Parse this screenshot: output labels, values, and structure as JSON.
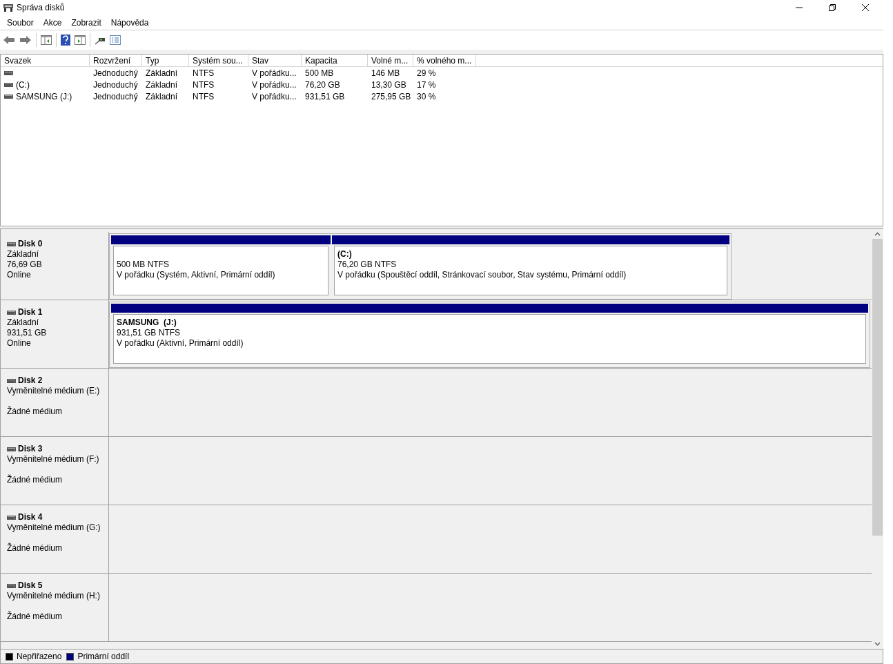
{
  "window": {
    "title": "Správa disků"
  },
  "menu": [
    "Soubor",
    "Akce",
    "Zobrazit",
    "Nápověda"
  ],
  "table": {
    "columns": [
      "Svazek",
      "Rozvržení",
      "Typ",
      "Systém sou...",
      "Stav",
      "Kapacita",
      "Volné m...",
      "% volného m..."
    ],
    "rows": [
      {
        "cells": [
          "",
          "Jednoduchý",
          "Základní",
          "NTFS",
          "V pořádku...",
          "500 MB",
          "146 MB",
          "29 %"
        ]
      },
      {
        "cells": [
          "(C:)",
          "Jednoduchý",
          "Základní",
          "NTFS",
          "V pořádku...",
          "76,20 GB",
          "13,30 GB",
          "17 %"
        ]
      },
      {
        "cells": [
          "SAMSUNG (J:)",
          "Jednoduchý",
          "Základní",
          "NTFS",
          "V pořádku...",
          "931,51 GB",
          "275,95 GB",
          "30 %"
        ]
      }
    ]
  },
  "disks": [
    {
      "kind": "basic",
      "name": "Disk 0",
      "type": "Základní",
      "size": "76,69 GB",
      "status": "Online",
      "partitions": [
        {
          "size_fs": "500 MB NTFS",
          "status": "V pořádku (Systém, Aktivní, Primární oddíl)"
        },
        {
          "label": "(C:)",
          "size_fs": "76,20 GB NTFS",
          "status": "V pořádku (Spouštěcí oddíl, Stránkovací soubor, Stav systému, Primární oddíl)"
        }
      ]
    },
    {
      "kind": "basic",
      "name": "Disk 1",
      "type": "Základní",
      "size": "931,51 GB",
      "status": "Online",
      "partitions": [
        {
          "label": "SAMSUNG  (J:)",
          "size_fs": "931,51 GB NTFS",
          "status": "V pořádku (Aktivní, Primární oddíl)"
        }
      ]
    },
    {
      "kind": "removable",
      "name": "Disk 2",
      "type": "Vyměnitelné médium (E:)",
      "status": "Žádné médium"
    },
    {
      "kind": "removable",
      "name": "Disk 3",
      "type": "Vyměnitelné médium (F:)",
      "status": "Žádné médium"
    },
    {
      "kind": "removable",
      "name": "Disk 4",
      "type": "Vyměnitelné médium (G:)",
      "status": "Žádné médium"
    },
    {
      "kind": "removable",
      "name": "Disk 5",
      "type": "Vyměnitelné médium (H:)",
      "status": "Žádné médium"
    }
  ],
  "legend": [
    {
      "label": "Nepřiřazeno",
      "color": "#000000"
    },
    {
      "label": "Primární oddíl",
      "color": "#000080"
    }
  ]
}
